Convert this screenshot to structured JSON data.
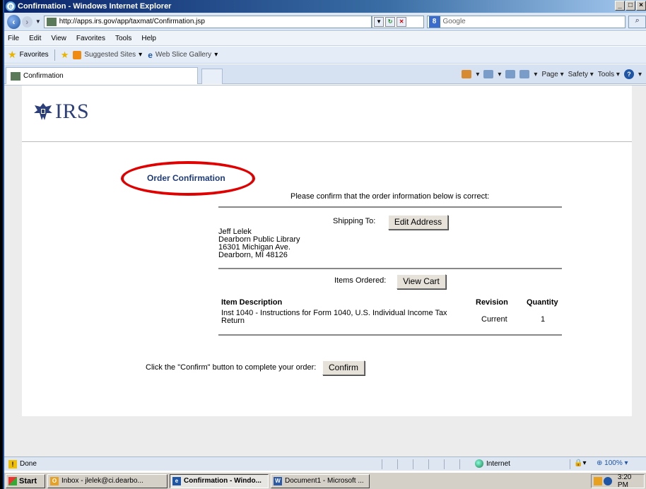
{
  "window": {
    "title": "Confirmation - Windows Internet Explorer",
    "min": "_",
    "max": "□",
    "close": "×"
  },
  "nav": {
    "url": "http://apps.irs.gov/app/taxmat/Confirmation.jsp",
    "search_placeholder": "Google",
    "search_engine_letter": "8"
  },
  "menu": [
    "File",
    "Edit",
    "View",
    "Favorites",
    "Tools",
    "Help"
  ],
  "favorites": {
    "label": "Favorites",
    "suggested_sites": "Suggested Sites",
    "web_slice_gallery": "Web Slice Gallery"
  },
  "tabs": {
    "active_label": "Confirmation"
  },
  "commandbar": {
    "page": "Page",
    "safety": "Safety",
    "tools": "Tools",
    "help": "?"
  },
  "page": {
    "logo_text": "IRS",
    "order_title": "Order Confirmation",
    "prompt": "Please confirm that the order information below is correct:",
    "shipping_label": "Shipping To:",
    "edit_address_button": "Edit Address",
    "address_lines": [
      "Jeff Lelek",
      "Dearborn Public Library",
      "16301 Michigan Ave.",
      "Dearborn, MI 48126"
    ],
    "items_label": "Items Ordered:",
    "view_cart_button": "View Cart",
    "table": {
      "headers": {
        "description": "Item Description",
        "revision": "Revision",
        "quantity": "Quantity"
      },
      "rows": [
        {
          "description": "Inst 1040 - Instructions for Form 1040, U.S. Individual Income Tax Return",
          "revision": "Current",
          "quantity": "1"
        }
      ]
    },
    "confirm_prompt": "Click the \"Confirm\" button to complete your order:",
    "confirm_button": "Confirm"
  },
  "statusbar": {
    "status": "Done",
    "zone": "Internet",
    "zoom": "100%"
  },
  "taskbar": {
    "start": "Start",
    "items": [
      "Inbox - jlelek@ci.dearbo...",
      "Confirmation - Windo...",
      "Document1 - Microsoft ..."
    ],
    "clock": "3:20 PM"
  }
}
